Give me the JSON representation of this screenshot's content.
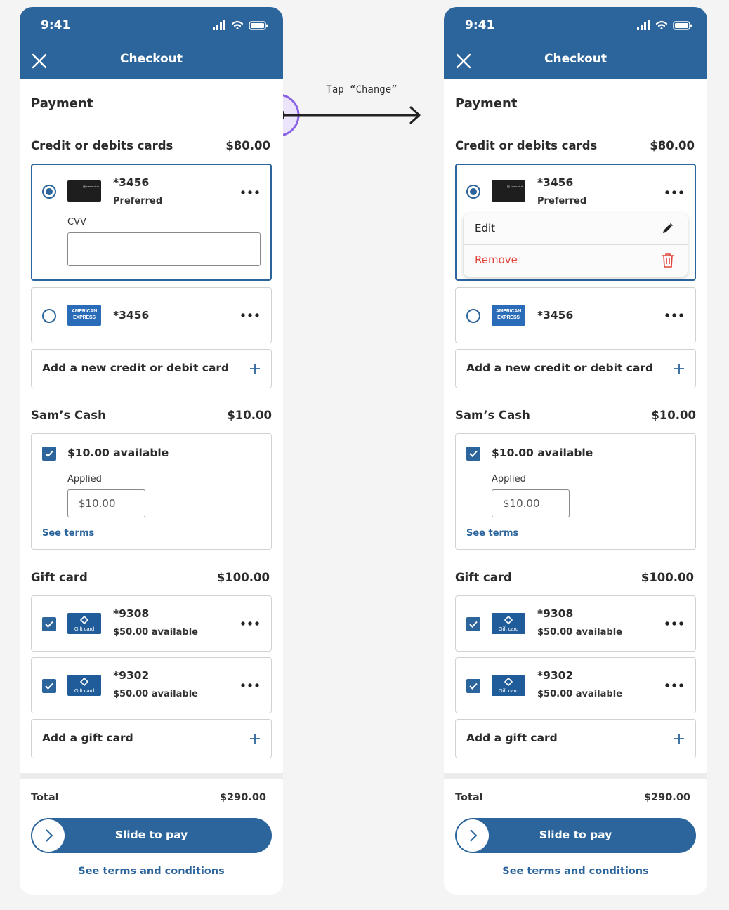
{
  "status_time": "9:41",
  "title": "Checkout",
  "annotation": "Tap “Change”",
  "payment_heading": "Payment",
  "cards_section": {
    "label": "Credit or debits cards",
    "amount": "$80.00"
  },
  "card_preferred": {
    "number": "*3456",
    "tag": "Preferred",
    "cvv_label": "CVV"
  },
  "card_amex": {
    "number": "*3456",
    "brand_text": "AMERICAN EXPRESS"
  },
  "add_card_label": "Add a new credit or debit card",
  "card_menu": {
    "edit": "Edit",
    "remove": "Remove"
  },
  "sams_cash": {
    "label": "Sam’s Cash",
    "amount": "$10.00",
    "available": "$10.00 available",
    "applied_label": "Applied",
    "applied_value": "$10.00",
    "terms_link": "See terms"
  },
  "gift_section": {
    "label": "Gift card",
    "amount": "$100.00"
  },
  "gift_cards": [
    {
      "number": "*9308",
      "available": "$50.00 available",
      "thumb_label": "Gift card"
    },
    {
      "number": "*9302",
      "available": "$50.00 available",
      "thumb_label": "Gift card"
    }
  ],
  "add_gift_label": "Add a gift card",
  "total": {
    "label": "Total",
    "amount": "$290.00"
  },
  "pay_button": "Slide to pay",
  "terms_conditions": "See terms and conditions",
  "colors": {
    "primary": "#2c659c",
    "danger": "#e0453a",
    "accent_ring": "#8a63e6"
  }
}
